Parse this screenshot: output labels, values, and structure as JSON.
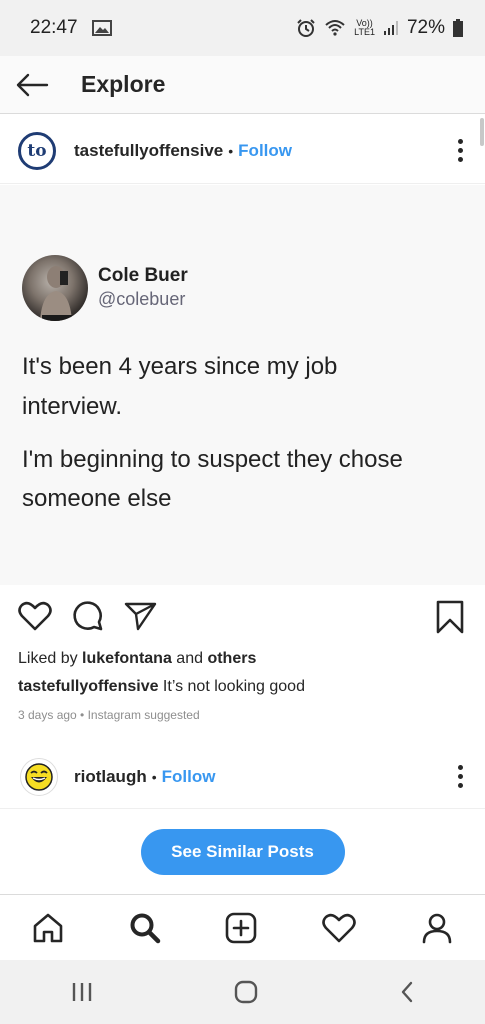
{
  "status_bar": {
    "time": "22:47",
    "network_top": "Vo))",
    "network_bottom": "LTE1",
    "battery": "72%"
  },
  "header": {
    "title": "Explore"
  },
  "post": {
    "username": "tastefullyoffensive",
    "separator": "•",
    "follow_label": "Follow",
    "avatar_text": "to",
    "tweet": {
      "name": "Cole Buer",
      "handle": "@colebuer",
      "line1": "It's been 4 years since my job",
      "line2": "interview.",
      "line3": "I'm beginning to suspect they chose",
      "line4": "someone else"
    },
    "liked_prefix": "Liked by ",
    "liked_user": "lukefontana",
    "liked_middle": " and ",
    "liked_others": "others",
    "caption_user": "tastefullyoffensive",
    "caption_text": " It’s not looking good",
    "meta": "3 days ago • Instagram suggested"
  },
  "next_post": {
    "username": "riotlaugh",
    "separator": "•",
    "follow_label": "Follow"
  },
  "see_similar_label": "See Similar Posts",
  "colors": {
    "accent": "#3897f0",
    "text": "#262626",
    "muted": "#8e8e8e"
  }
}
